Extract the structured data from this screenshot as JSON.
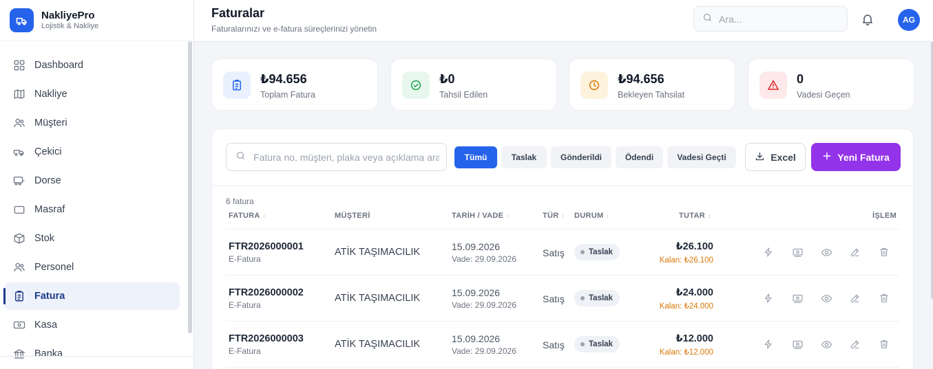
{
  "brand": {
    "name": "NakliyePro",
    "subtitle": "Lojistik & Nakliye"
  },
  "sidebar": {
    "items": [
      {
        "label": "Dashboard",
        "icon": "grid-icon",
        "active": false
      },
      {
        "label": "Nakliye",
        "icon": "map-icon",
        "active": false
      },
      {
        "label": "Müşteri",
        "icon": "users-icon",
        "active": false
      },
      {
        "label": "Çekici",
        "icon": "truck-icon",
        "active": false
      },
      {
        "label": "Dorse",
        "icon": "trailer-icon",
        "active": false
      },
      {
        "label": "Masraf",
        "icon": "wallet-icon",
        "active": false
      },
      {
        "label": "Stok",
        "icon": "box-icon",
        "active": false
      },
      {
        "label": "Personel",
        "icon": "people-icon",
        "active": false
      },
      {
        "label": "Fatura",
        "icon": "invoice-icon",
        "active": true
      },
      {
        "label": "Kasa",
        "icon": "cash-icon",
        "active": false
      },
      {
        "label": "Banka",
        "icon": "bank-icon",
        "active": false
      }
    ]
  },
  "header": {
    "title": "Faturalar",
    "subtitle": "Faturalarınızı ve e-fatura süreçlerinizi yönetin",
    "search_placeholder": "Ara...",
    "avatar_initials": "AG"
  },
  "stats": [
    {
      "value": "₺94.656",
      "label": "Toplam Fatura",
      "icon": "invoice-icon",
      "color": "#2563eb",
      "bg": "#eaf1fe"
    },
    {
      "value": "₺0",
      "label": "Tahsil Edilen",
      "icon": "check-circle-icon",
      "color": "#16a34a",
      "bg": "#e8f7ee"
    },
    {
      "value": "₺94.656",
      "label": "Bekleyen Tahsilat",
      "icon": "clock-icon",
      "color": "#d97706",
      "bg": "#fdf3dd"
    },
    {
      "value": "0",
      "label": "Vadesi Geçen",
      "icon": "alert-icon",
      "color": "#dc2626",
      "bg": "#fde8ea"
    }
  ],
  "toolbar": {
    "search_placeholder": "Fatura no, müşteri, plaka veya açıklama ara...",
    "filters": [
      "Tümü",
      "Taslak",
      "Gönderildi",
      "Ödendi",
      "Vadesi Geçti"
    ],
    "active_filter": "Tümü",
    "excel_label": "Excel",
    "new_label": "Yeni Fatura"
  },
  "table": {
    "count_label": "6 fatura",
    "columns": {
      "invoice": "FATURA",
      "customer": "MÜŞTERİ",
      "date": "TARİH / VADE",
      "kind": "TÜR",
      "status": "DURUM",
      "amount": "TUTAR",
      "actions": "İŞLEM"
    },
    "rows": [
      {
        "no": "FTR2026000001",
        "type": "E-Fatura",
        "customer": "ATİK TAŞIMACILIK",
        "date": "15.09.2026",
        "due": "Vade: 29.09.2026",
        "kind": "Satış",
        "status": "Taslak",
        "amount": "₺26.100",
        "remaining": "Kalan: ₺26.100"
      },
      {
        "no": "FTR2026000002",
        "type": "E-Fatura",
        "customer": "ATİK TAŞIMACILIK",
        "date": "15.09.2026",
        "due": "Vade: 29.09.2026",
        "kind": "Satış",
        "status": "Taslak",
        "amount": "₺24.000",
        "remaining": "Kalan: ₺24.000"
      },
      {
        "no": "FTR2026000003",
        "type": "E-Fatura",
        "customer": "ATİK TAŞIMACILIK",
        "date": "15.09.2026",
        "due": "Vade: 29.09.2026",
        "kind": "Satış",
        "status": "Taslak",
        "amount": "₺12.000",
        "remaining": "Kalan: ₺12.000"
      }
    ]
  },
  "colors": {
    "primary": "#2563eb",
    "accent": "#9333ea",
    "warning": "#d97706"
  }
}
